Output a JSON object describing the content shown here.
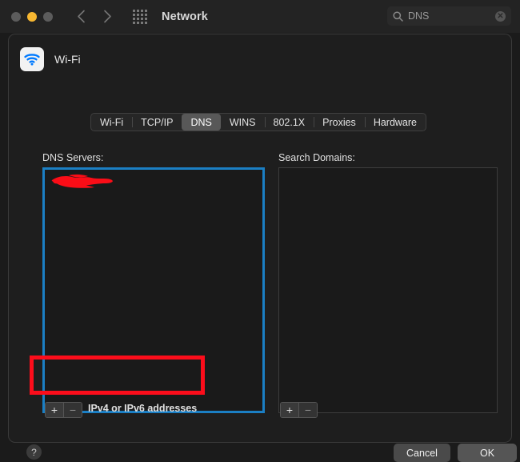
{
  "window": {
    "title": "Network",
    "traffic_lights": [
      {
        "name": "close",
        "color": "#5c5c5c"
      },
      {
        "name": "minimize",
        "color": "#f7b731"
      },
      {
        "name": "maximize",
        "color": "#5c5c5c"
      }
    ],
    "nav": {
      "back_icon": "chevron-left-icon",
      "forward_icon": "chevron-right-icon"
    },
    "show_all_icon": "grid-dots-icon"
  },
  "search": {
    "value": "DNS",
    "placeholder": "Search",
    "icon": "search-icon",
    "clear_icon": "clear-circle-icon",
    "clear_glyph": "✕"
  },
  "service": {
    "icon": "wifi-icon",
    "name": "Wi-Fi"
  },
  "tabs": [
    {
      "label": "Wi-Fi",
      "selected": false
    },
    {
      "label": "TCP/IP",
      "selected": false
    },
    {
      "label": "DNS",
      "selected": true
    },
    {
      "label": "WINS",
      "selected": false
    },
    {
      "label": "802.1X",
      "selected": false
    },
    {
      "label": "Proxies",
      "selected": false
    },
    {
      "label": "Hardware",
      "selected": false
    }
  ],
  "dns_panel": {
    "dns_servers": {
      "label": "DNS Servers:",
      "entries": [],
      "redacted_entry": true,
      "highlight_color": "#1b7fc4",
      "add_glyph": "+",
      "remove_glyph": "−",
      "hint": "IPv4 or IPv6 addresses"
    },
    "search_domains": {
      "label": "Search Domains:",
      "entries": [],
      "add_glyph": "+",
      "remove_glyph": "−"
    }
  },
  "footer": {
    "help_glyph": "?",
    "cancel_label": "Cancel",
    "ok_label": "OK"
  },
  "annotations": {
    "rect_color": "#fc0d1b",
    "scribble_color": "#fb0d17"
  }
}
